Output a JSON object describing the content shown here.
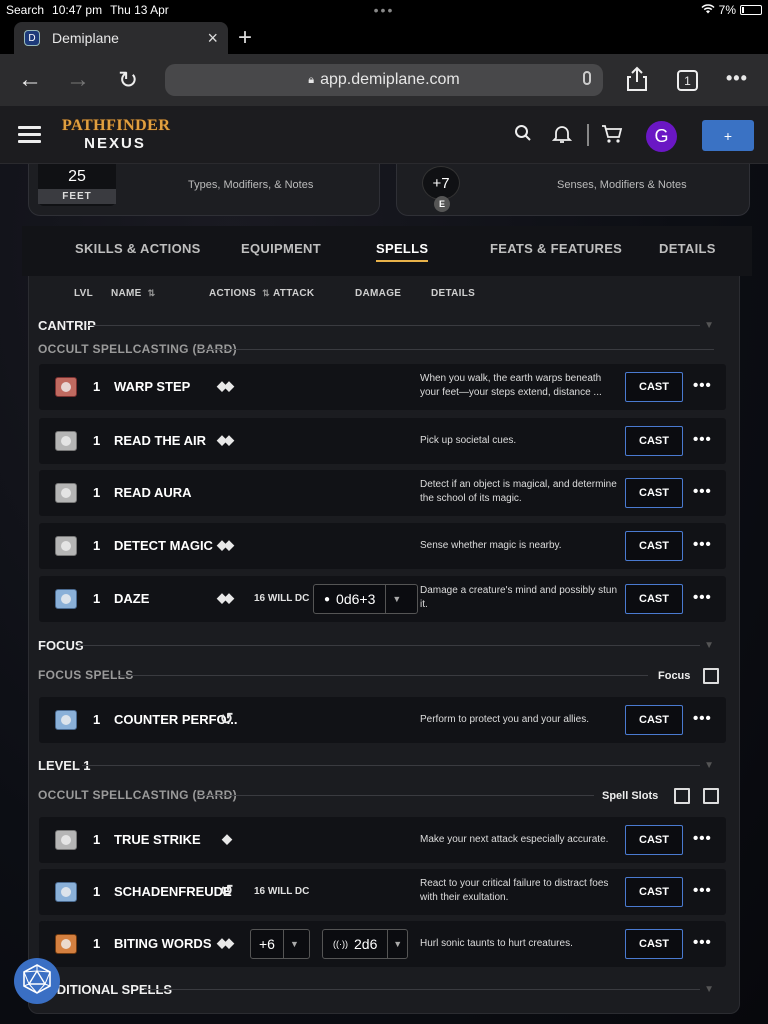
{
  "status": {
    "left": "Search",
    "time": "10:47 pm",
    "date": "Thu 13 Apr",
    "dots": "•••",
    "battery": "7%"
  },
  "browser": {
    "tab_title": "Demiplane",
    "favicon": "D",
    "url": "app.demiplane.com",
    "tabs_count": "1"
  },
  "header": {
    "logo_line1": "PATHFINDER",
    "logo_line2": "NEXUS",
    "avatar": "G",
    "plus": "+"
  },
  "cards": {
    "speed_value": "25",
    "speed_unit": "FEET",
    "speed_note": "Types, Modifiers, & Notes",
    "perception_value": "+7",
    "perception_badge": "E",
    "perception_note": "Senses, Modifiers & Notes"
  },
  "tabs": [
    "SKILLS & ACTIONS",
    "EQUIPMENT",
    "SPELLS",
    "FEATS & FEATURES",
    "DETAILS"
  ],
  "columns": {
    "lvl": "LVL",
    "name": "NAME",
    "actions": "ACTIONS",
    "attack": "ATTACK",
    "damage": "DAMAGE",
    "details": "DETAILS"
  },
  "sections": {
    "cantrip": "CANTRIP",
    "cantrip_sub": "OCCULT SPELLCASTING (BARD)",
    "focus": "FOCUS",
    "focus_sub": "FOCUS SPELLS",
    "focus_label": "Focus",
    "level1": "LEVEL 1",
    "level1_sub": "OCCULT SPELLCASTING (BARD)",
    "slots_label": "Spell Slots",
    "additional": "ADDITIONAL SPELLS"
  },
  "cast_label": "CAST",
  "more_label": "•••",
  "spells": [
    {
      "lvl": "1",
      "name": "WARP STEP",
      "actions": "◆◆",
      "attack": "",
      "desc": "When you walk, the earth warps beneath your feet—your steps extend, distance ..."
    },
    {
      "lvl": "1",
      "name": "READ THE AIR",
      "actions": "◆◆",
      "attack": "",
      "desc": "Pick up societal cues."
    },
    {
      "lvl": "1",
      "name": "READ AURA",
      "actions": "",
      "attack": "",
      "desc": "Detect if an object is magical, and determine the school of its magic."
    },
    {
      "lvl": "1",
      "name": "DETECT MAGIC",
      "actions": "◆◆",
      "attack": "",
      "desc": "Sense whether magic is nearby."
    },
    {
      "lvl": "1",
      "name": "DAZE",
      "actions": "◆◆",
      "attack": "16 WILL DC",
      "damage": "0d6+3",
      "desc": "Damage a creature's mind and possibly stun it."
    },
    {
      "lvl": "1",
      "name": "COUNTER PERFO...",
      "actions": "↺",
      "attack": "",
      "desc": "Perform to protect you and your allies."
    },
    {
      "lvl": "1",
      "name": "TRUE STRIKE",
      "actions": "◆",
      "attack": "",
      "desc": "Make your next attack especially accurate."
    },
    {
      "lvl": "1",
      "name": "SCHADENFREUDE",
      "actions": "↺",
      "attack": "16 WILL DC",
      "desc": "React to your critical failure to distract foes with their exultation."
    },
    {
      "lvl": "1",
      "name": "BITING WORDS",
      "actions": "◆◆",
      "attack_value": "+6",
      "damage": "2d6",
      "desc": "Hurl sonic taunts to hurt creatures."
    }
  ],
  "colors": {
    "accent": "#3a72c4",
    "tab_underline": "#e8b24a",
    "avatar": "#6a17c4"
  }
}
